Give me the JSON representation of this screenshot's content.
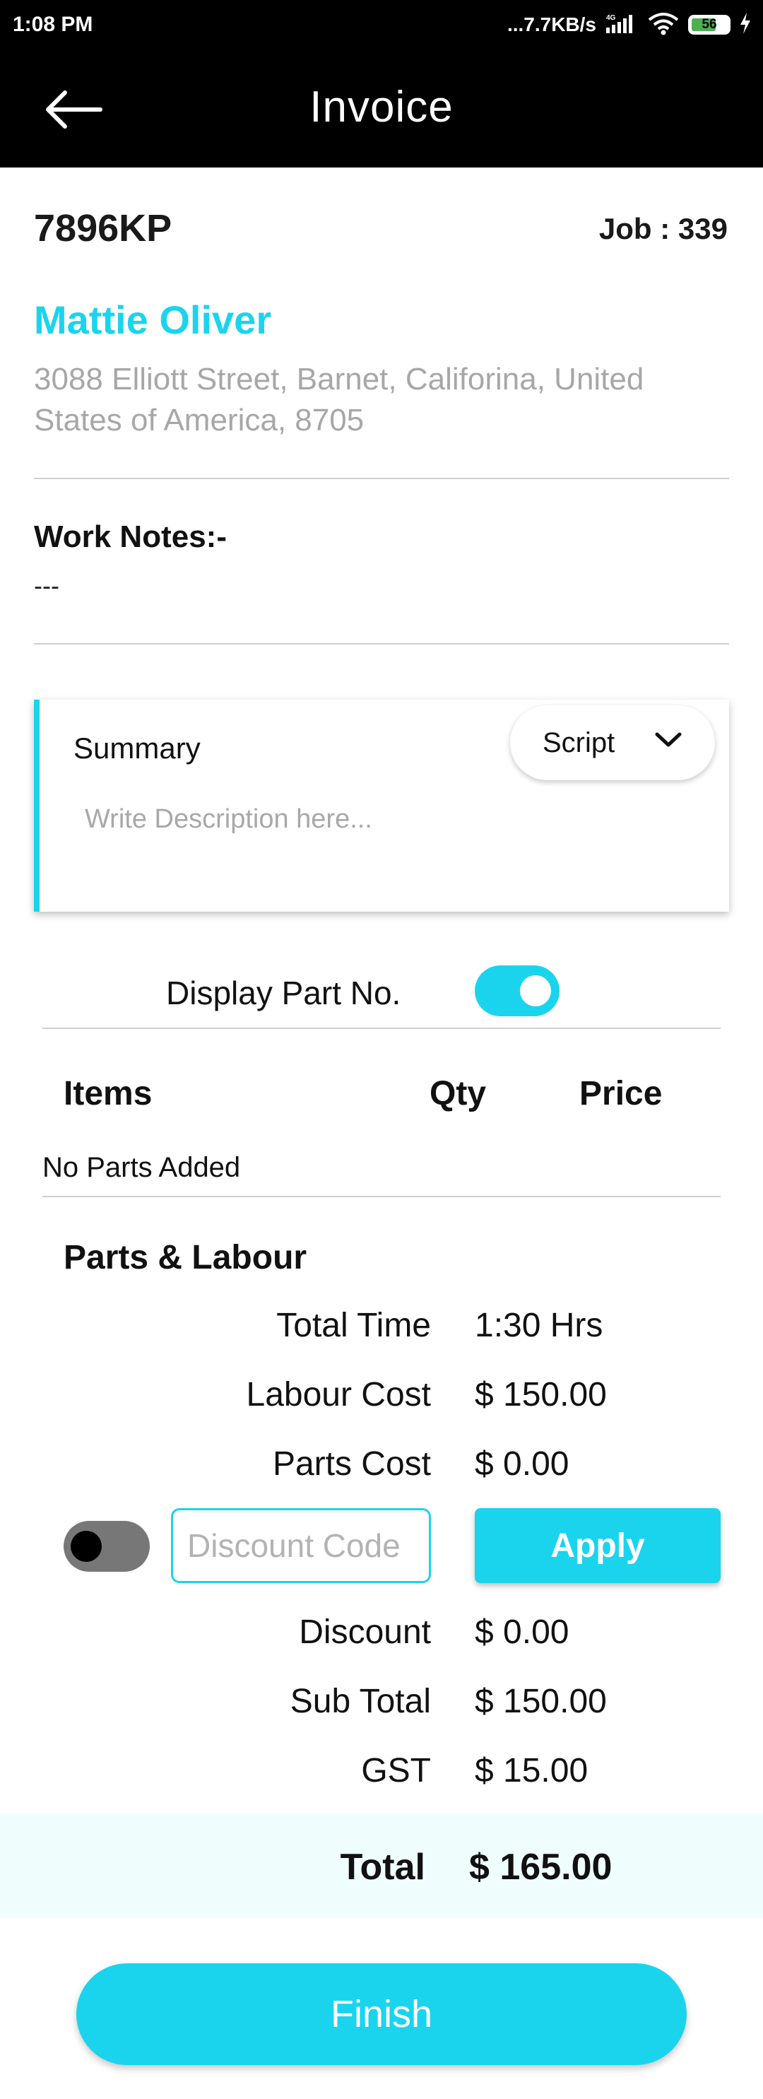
{
  "status_bar": {
    "time": "1:08 PM",
    "network_speed": "...7.7KB/s",
    "network_type": "4G",
    "battery": "56",
    "icons": [
      "signal-icon",
      "wifi-icon",
      "battery-icon",
      "charging-icon"
    ]
  },
  "app_bar": {
    "title": "Invoice",
    "back_icon": "arrow-left-icon"
  },
  "invoice": {
    "code": "7896KP",
    "job": "Job : 339"
  },
  "customer": {
    "name": "Mattie Oliver",
    "address": "3088  Elliott Street, Barnet, Califorina, United States of America, 8705"
  },
  "work_notes": {
    "label": "Work Notes:-",
    "value": "---"
  },
  "summary": {
    "label": "Summary",
    "placeholder": "Write Description here...",
    "script_label": "Script",
    "script_icon": "chevron-down-icon"
  },
  "display_part_no": {
    "label": "Display Part No.",
    "enabled": true
  },
  "items_table": {
    "headers": [
      "Items",
      "Qty",
      "Price"
    ],
    "empty_text": "No Parts Added"
  },
  "parts_labour": {
    "title": "Parts & Labour",
    "rows": [
      {
        "label": "Total Time",
        "value": "1:30 Hrs"
      },
      {
        "label": "Labour Cost",
        "value": "$ 150.00"
      },
      {
        "label": "Parts Cost",
        "value": "$ 0.00"
      }
    ],
    "discount_toggle_enabled": false,
    "discount_placeholder": "Discount Code",
    "apply_label": "Apply",
    "after_rows": [
      {
        "label": "Discount",
        "value": "$ 0.00"
      },
      {
        "label": "Sub Total",
        "value": "$ 150.00"
      },
      {
        "label": "GST",
        "value": "$ 15.00"
      }
    ]
  },
  "total": {
    "label": "Total",
    "value": "$ 165.00"
  },
  "finish_label": "Finish",
  "colors": {
    "accent": "#1ad4ee",
    "app_bar": "#000000",
    "total_band": "#effdfd",
    "address": "#a7a7a7"
  }
}
